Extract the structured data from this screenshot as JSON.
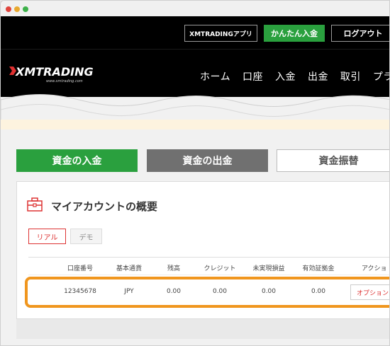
{
  "window": {
    "controls": [
      "close",
      "minimize",
      "maximize"
    ]
  },
  "topbar": {
    "app_label": "XMTRADINGアプリ",
    "deposit_label": "かんたん入金",
    "logout_label": "ログアウト"
  },
  "navbar": {
    "logo_text": "XMTRADING",
    "logo_sub": "www.xmtrading.com",
    "items": [
      "ホーム",
      "口座",
      "入金",
      "出金",
      "取引",
      "プラット"
    ]
  },
  "actions": {
    "deposit": "資金の入金",
    "withdraw": "資金の出金",
    "transfer": "資金振替"
  },
  "panel": {
    "title": "マイアカウントの概要",
    "tabs": {
      "real": "リアル",
      "demo": "デモ"
    },
    "columns": [
      "口座番号",
      "基本通貨",
      "残高",
      "クレジット",
      "未実現損益",
      "有効証拠金",
      "アクショ"
    ],
    "row": {
      "account": "12345678",
      "currency": "JPY",
      "balance": "0.00",
      "credit": "0.00",
      "unrealized": "0.00",
      "equity": "0.00",
      "action": "オプションを"
    }
  },
  "colors": {
    "accent_green": "#2aa03e",
    "highlight_orange": "#f0961e",
    "brand_red": "#d33333"
  }
}
